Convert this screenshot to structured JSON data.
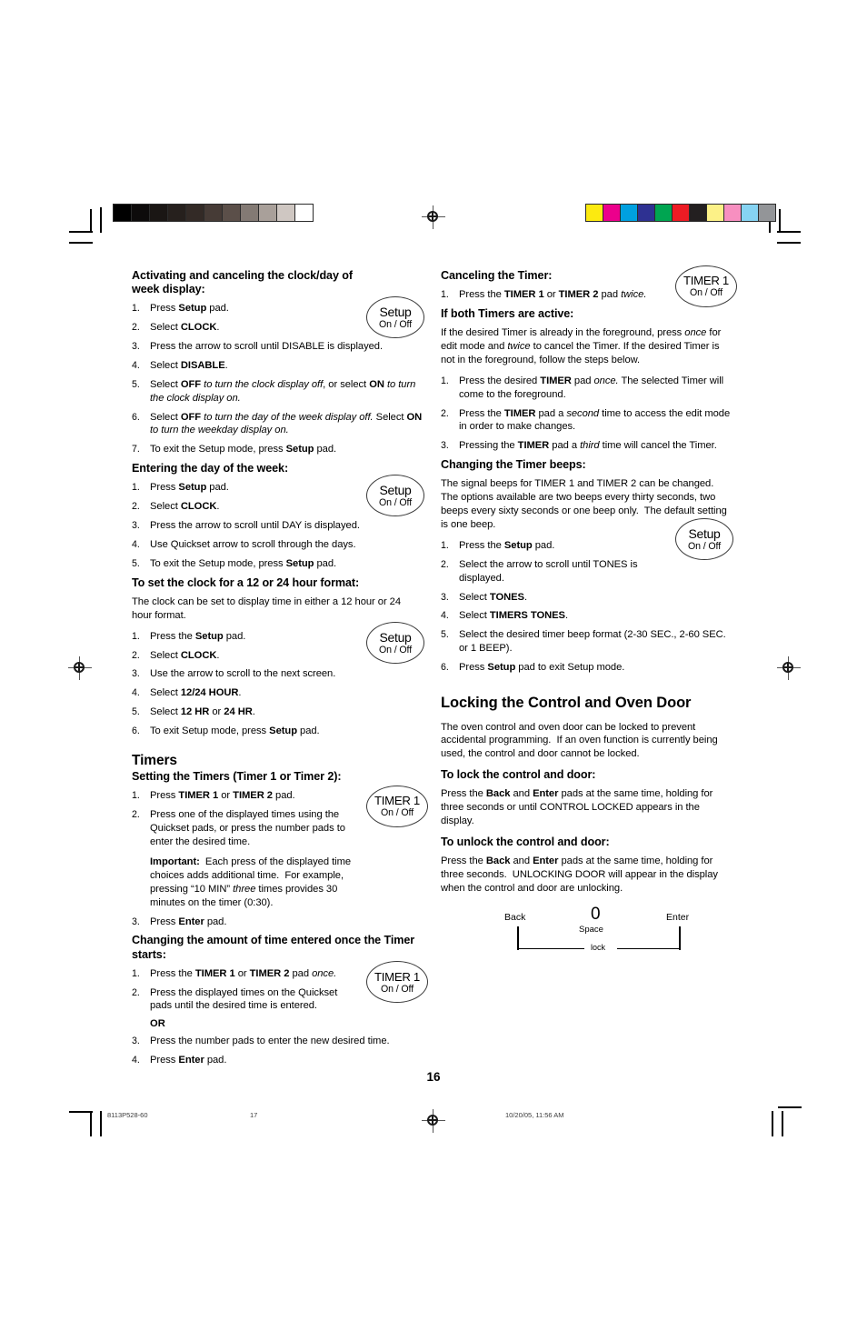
{
  "document": {
    "page_number": "16",
    "footer": {
      "doc_code": "8113P528-60",
      "sheet": "17",
      "timestamp": "10/20/05, 11:56 AM"
    },
    "color_bars": {
      "grayscale": [
        "#000000",
        "#0d0b0b",
        "#1a1614",
        "#26201d",
        "#332a26",
        "#463b36",
        "#5b4f49",
        "#837a74",
        "#a9a09a",
        "#cfc7c2",
        "#ffffff"
      ],
      "color": [
        "#fcea10",
        "#ec008c",
        "#00a0e0",
        "#2e3192",
        "#00a551",
        "#ed1c24",
        "#231f20",
        "#fcf187",
        "#f78fc0",
        "#86d3f2",
        "#939598"
      ]
    }
  },
  "left_column": {
    "clock_display": {
      "heading": "Activating and canceling the clock/day of week display:",
      "pad": {
        "label": "Setup",
        "sub": "On / Off"
      },
      "steps": [
        "Press <b>Setup</b> pad.",
        "Select <b>CLOCK</b>.",
        "Press the arrow to scroll until DISABLE is displayed.",
        "Select <b>DISABLE</b>.",
        "Select <b>OFF</b> <i>to turn the clock display off</i>, or select <b>ON</b> <i>to turn the clock display on.</i>",
        "Select <b>OFF</b> <i>to turn the day of the week display off.</i> Select <b>ON</b> <i>to turn the weekday display on.</i>",
        "To exit the Setup mode, press <b>Setup</b> pad."
      ]
    },
    "day_of_week": {
      "heading": "Entering the day of the week:",
      "pad": {
        "label": "Setup",
        "sub": "On / Off"
      },
      "steps": [
        "Press <b>Setup</b> pad.",
        "Select <b>CLOCK</b>.",
        "Press the arrow to scroll until DAY is displayed.",
        "Use Quickset arrow to scroll through the days.",
        "To exit the Setup mode, press <b>Setup</b> pad."
      ]
    },
    "hour_format": {
      "heading": "To set the clock for a 12 or 24 hour format:",
      "intro": "The clock can be set to display time in either a 12 hour or 24 hour format.",
      "pad": {
        "label": "Setup",
        "sub": "On / Off"
      },
      "steps": [
        "Press the <b>Setup</b> pad.",
        "Select <b>CLOCK</b>.",
        "Use the arrow to scroll to the next screen.",
        "Select <b>12/24 HOUR</b>.",
        "Select <b>12 HR</b> or <b>24 HR</b>.",
        "To exit Setup mode, press <b>Setup</b> pad."
      ]
    },
    "timers": {
      "title": "Timers",
      "setting": {
        "heading": "Setting the Timers (Timer 1 or Timer 2):",
        "pad": {
          "label": "TIMER 1",
          "sub": "On / Off"
        },
        "steps": [
          "Press <b>TIMER 1</b> or <b>TIMER 2</b> pad.",
          "Press one of the displayed times using the Quickset pads, or press the number pads to enter the desired time.",
          "Press <b>Enter</b> pad."
        ],
        "important": "<b>Important:</b>&nbsp; Each press of the displayed time choices adds additional time.&nbsp; For example, pressing “10 MIN” <i>three</i> times provides 30 minutes on the timer (0:30)."
      },
      "changing": {
        "heading": "Changing the amount of time entered once the Timer starts:",
        "pad": {
          "label": "TIMER 1",
          "sub": "On / Off"
        },
        "step1": "Press the <b>TIMER 1</b> or <b>TIMER 2</b> pad <i>once.</i>",
        "step2": "Press the displayed times on the Quickset pads until the desired time is entered.",
        "or": "OR",
        "step3": "Press the number pads to enter the new desired time.",
        "step4": "Press <b>Enter</b> pad."
      }
    }
  },
  "right_column": {
    "canceling": {
      "heading": "Canceling the Timer:",
      "pad": {
        "label": "TIMER 1",
        "sub": "On / Off"
      },
      "steps": [
        "Press the <b>TIMER 1</b> or <b>TIMER 2</b> pad <i>twice.</i>"
      ]
    },
    "both_active": {
      "heading": "If both Timers are active:",
      "intro": "If the desired Timer is already in the foreground, press <i>once</i> for edit mode and <i>twice</i> to cancel the Timer. If the desired Timer is not in the foreground, follow the steps below.",
      "steps": [
        "Press the desired <b>TIMER</b> pad <i>once.</i> The selected Timer will come to the foreground.",
        "Press the <b>TIMER</b> pad a <i>second</i> time to access the edit mode in order to make changes.",
        "Pressing the <b>TIMER</b> pad a <i>third</i> time will cancel the Timer."
      ]
    },
    "timer_beeps": {
      "heading": "Changing the Timer beeps:",
      "intro": "The signal beeps for TIMER 1 and TIMER 2 can be changed. The options available are two beeps every thirty seconds, two beeps every sixty seconds or one beep only.&nbsp; The default setting is one beep.",
      "pad": {
        "label": "Setup",
        "sub": "On / Off"
      },
      "steps": [
        "Press the <b>Setup</b> pad.",
        "Select the arrow to scroll until TONES is displayed.",
        "Select <b>TONES</b>.",
        "Select <b>TIMERS TONES</b>.",
        "Select the desired timer beep format (2-30 SEC., 2-60 SEC. or 1 BEEP).",
        "Press <b>Setup</b> pad to exit Setup mode."
      ]
    },
    "locking": {
      "title": "Locking the Control and Oven Door",
      "intro": "The oven control and oven door can be locked to prevent accidental programming.&nbsp; If an oven function is currently being used, the control and door cannot be locked.",
      "lock": {
        "heading": "To lock the control and door:",
        "body": "Press the <b>Back</b> and <b>Enter</b> pads at the same time, holding for three seconds or until CONTROL LOCKED appears in the display."
      },
      "unlock": {
        "heading": "To unlock the control and door:",
        "body": "Press the <b>Back</b> and <b>Enter</b> pads at the same time, holding for three seconds.&nbsp; UNLOCKING DOOR will appear in the display when the control and door are unlocking."
      },
      "diagram": {
        "back": "Back",
        "zero": "0",
        "space": "Space",
        "enter": "Enter",
        "lock": "lock"
      }
    }
  }
}
